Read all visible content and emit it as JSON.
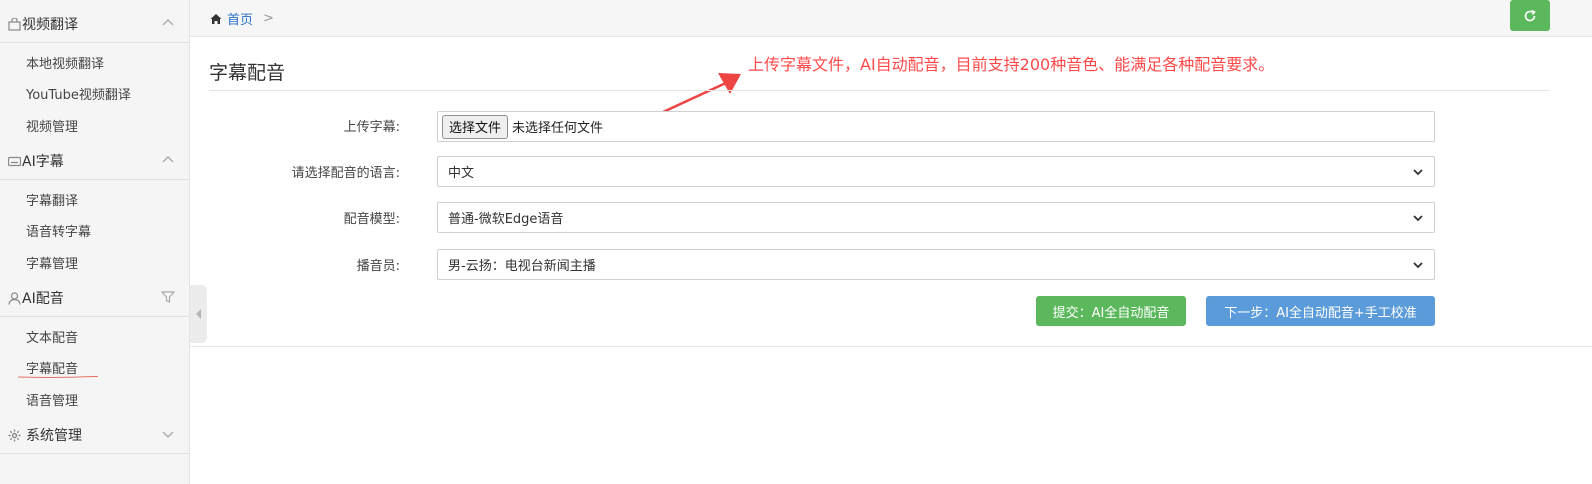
{
  "sidebar": {
    "groups": [
      {
        "label": "视频翻译",
        "icon": "bag-icon",
        "expanded": true,
        "items": [
          "本地视频翻译",
          "YouTube视频翻译",
          "视频管理"
        ]
      },
      {
        "label": "AI字幕",
        "icon": "subtitle-icon",
        "expanded": true,
        "items": [
          "字幕翻译",
          "语音转字幕",
          "字幕管理"
        ]
      },
      {
        "label": "AI配音",
        "icon": "person-icon",
        "expanded": true,
        "items": [
          "文本配音",
          "字幕配音",
          "语音管理"
        ]
      },
      {
        "label": "系统管理",
        "icon": "gear-icon",
        "expanded": false,
        "items": []
      }
    ],
    "active_item": "字幕配音"
  },
  "topbar": {
    "breadcrumb_home": "首页",
    "breadcrumb_sep": ">"
  },
  "main": {
    "title": "字幕配音",
    "annotation": "上传字幕文件，AI自动配音，目前支持200种音色、能满足各种配音要求。",
    "form": {
      "upload_label": "上传字幕:",
      "upload_button": "选择文件",
      "upload_status": "未选择任何文件",
      "language_label": "请选择配音的语言:",
      "language_value": "中文",
      "model_label": "配音模型:",
      "model_value": "普通-微软Edge语音",
      "voice_label": "播音员:",
      "voice_value": "男-云扬：电视台新闻主播"
    },
    "submit_label": "提交：AI全自动配音",
    "next_label": "下一步：AI全自动配音+手工校准"
  },
  "colors": {
    "accent_green": "#5cb85c",
    "accent_blue": "#5b9bd9",
    "annotation_red": "#ff4a4a",
    "link_blue": "#2a6fc9"
  }
}
